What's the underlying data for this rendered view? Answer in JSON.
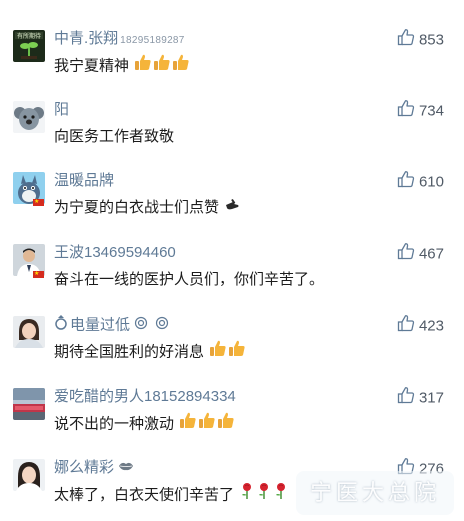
{
  "comments": [
    {
      "nickname": "中青.张翔",
      "name_suffix": "18295189287",
      "text": "我宁夏精神",
      "emojis": [
        "thumbs-up",
        "thumbs-up",
        "thumbs-up"
      ],
      "likes": "853",
      "avatar": "tree-avatar"
    },
    {
      "nickname": "阳",
      "name_suffix": "",
      "text": "向医务工作者致敬",
      "emojis": [],
      "likes": "734",
      "avatar": "koala-avatar"
    },
    {
      "nickname": "温暖品牌",
      "name_suffix": "",
      "text": "为宁夏的白衣战士们点赞",
      "emojis": [
        "pointing-hand"
      ],
      "likes": "610",
      "avatar": "totoro-avatar"
    },
    {
      "nickname": "王波13469594460",
      "name_suffix": "",
      "text": "奋斗在一线的医护人员们，你们辛苦了。",
      "emojis": [],
      "likes": "467",
      "avatar": "man-avatar"
    },
    {
      "nickname": "电量过低",
      "name_suffix": "",
      "text": "期待全国胜利的好消息",
      "emojis": [
        "thumbs-up",
        "thumbs-up"
      ],
      "likes": "423",
      "avatar": "girl-avatar"
    },
    {
      "nickname": "爱吃醋的男人18152894334",
      "name_suffix": "",
      "text": "说不出的一种激动",
      "emojis": [
        "thumbs-up",
        "thumbs-up",
        "thumbs-up"
      ],
      "likes": "317",
      "avatar": "banner-avatar"
    },
    {
      "nickname": "娜么精彩",
      "name_suffix": "",
      "text": "太棒了，白衣天使们辛苦了",
      "emojis": [
        "rose",
        "rose",
        "rose"
      ],
      "likes": "276",
      "avatar": "lady-avatar"
    }
  ],
  "watermark": "宁医大总院",
  "colors": {
    "nickname": "#5f7a96",
    "comment_text": "#1c1c1c",
    "like_count": "#505a66",
    "thumb_emoji": "#f5b43a",
    "flag_red": "#d52b1e"
  }
}
